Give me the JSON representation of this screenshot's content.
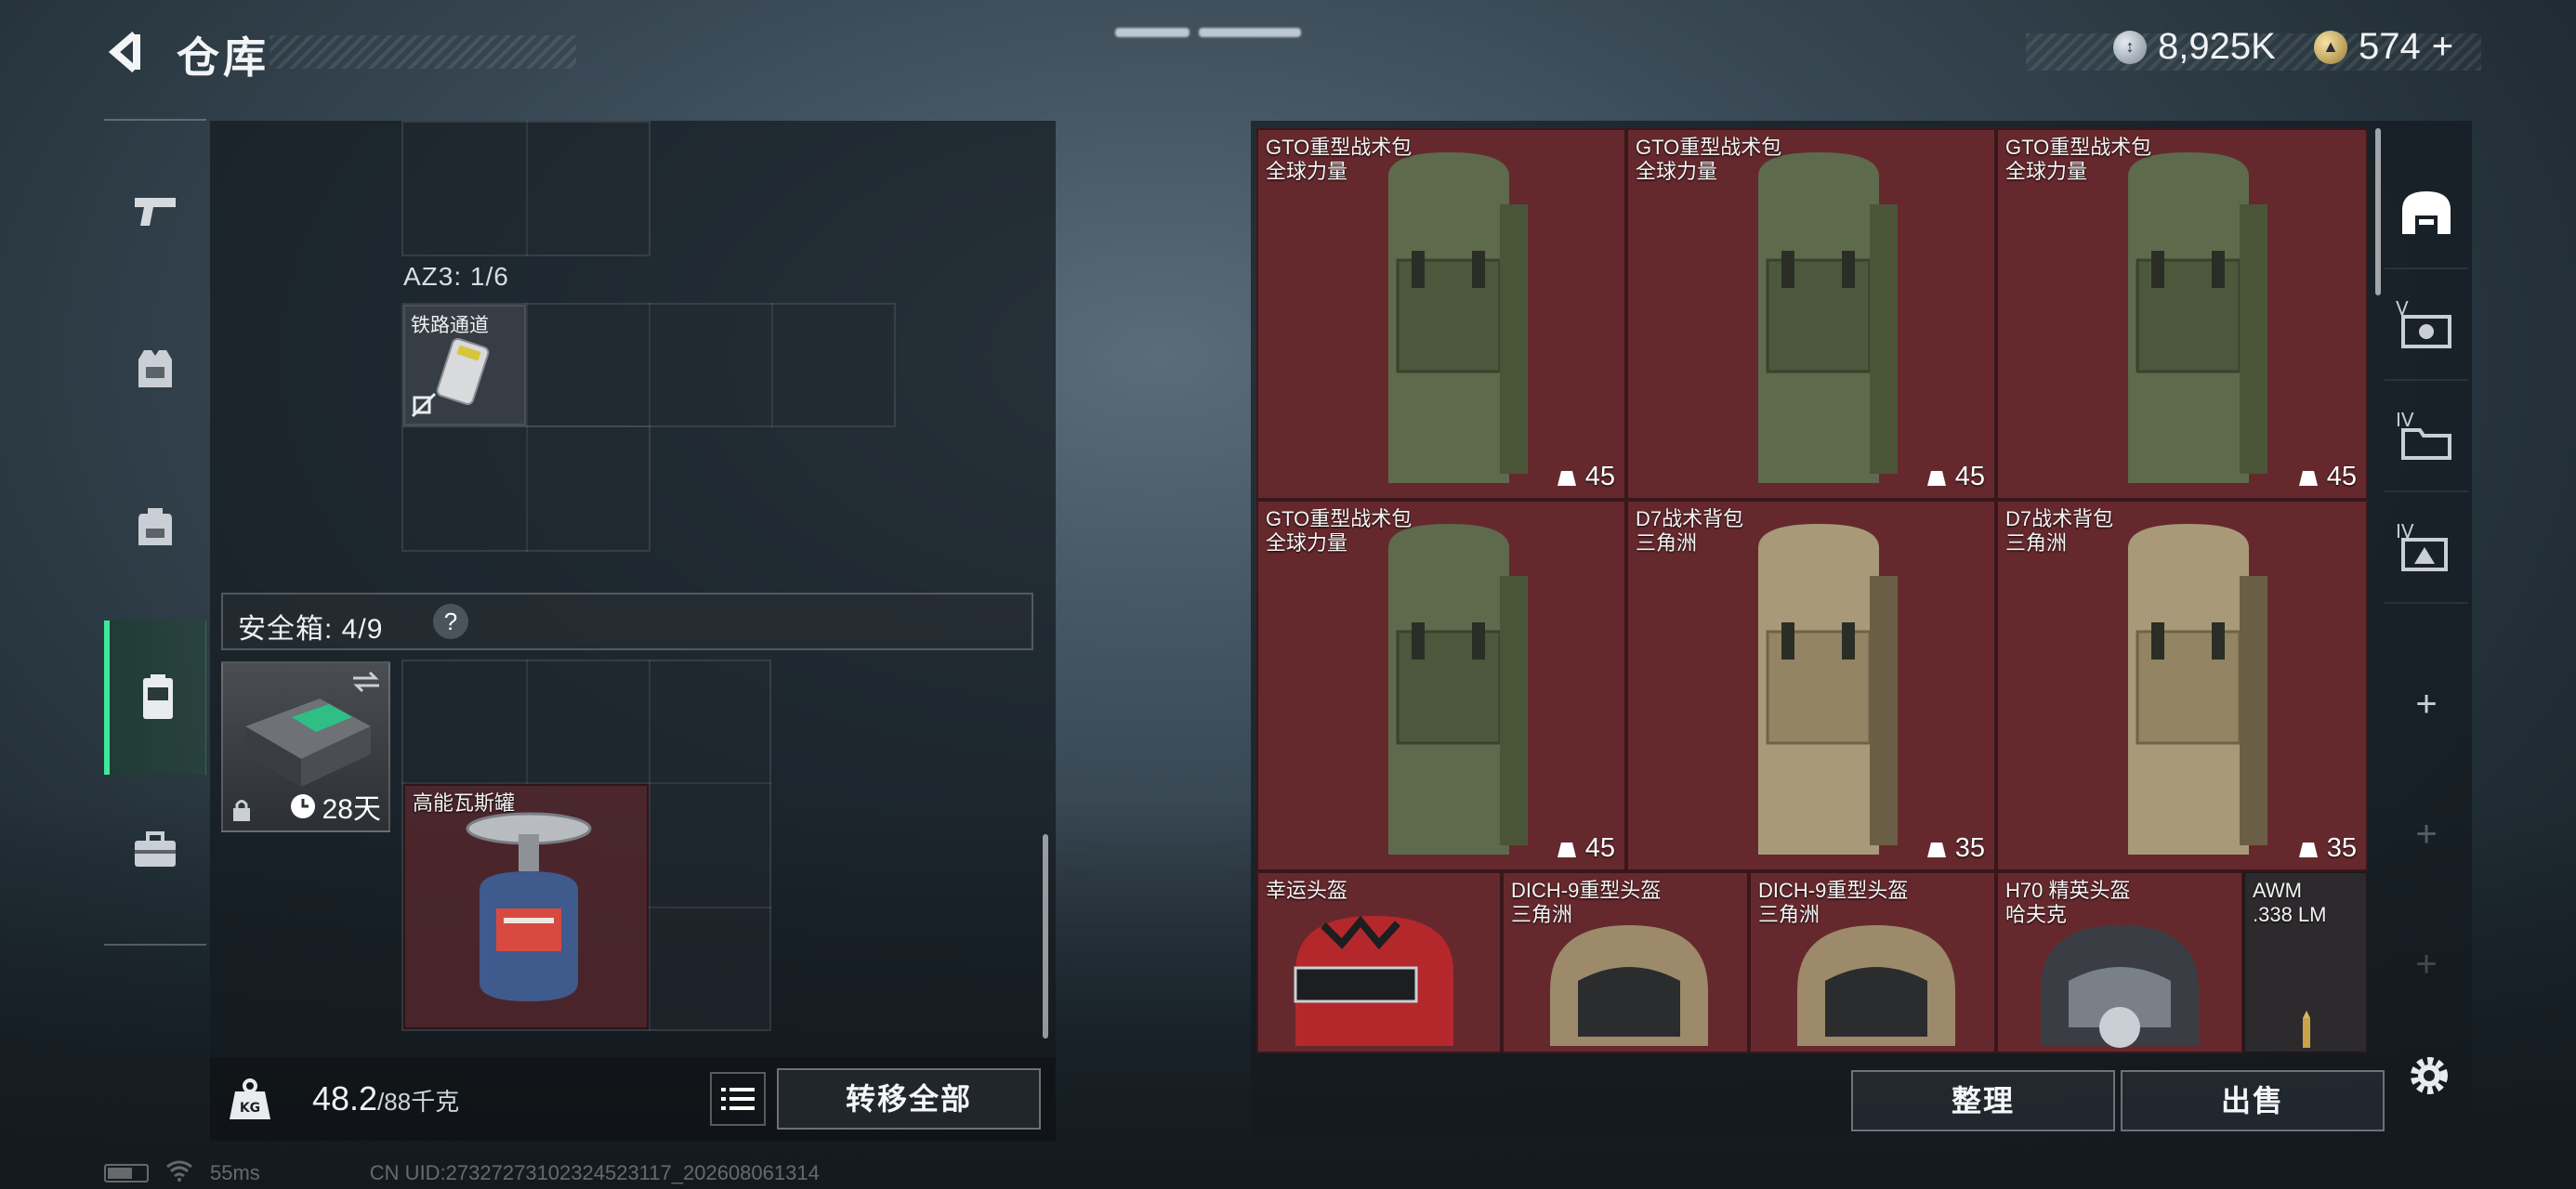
{
  "header": {
    "title": "仓库",
    "currency_silver": "8,925K",
    "currency_gold": "574",
    "currency_gold_plus": "+"
  },
  "left_panel": {
    "az3_label": "AZ3: 1/6",
    "railway_item": "铁路通道",
    "safebox_label": "安全箱: 4/9",
    "safebox_help": "?",
    "safebox_days": "28天",
    "gas_item": "高能瓦斯罐",
    "weight_current": "48.2",
    "weight_max": "/88千克",
    "transfer_all": "转移全部"
  },
  "inventory": {
    "items": [
      {
        "name": "GTO重型战术包",
        "sub": "全球力量",
        "durability": "45"
      },
      {
        "name": "GTO重型战术包",
        "sub": "全球力量",
        "durability": "45"
      },
      {
        "name": "GTO重型战术包",
        "sub": "全球力量",
        "durability": "45"
      },
      {
        "name": "GTO重型战术包",
        "sub": "全球力量",
        "durability": "45"
      },
      {
        "name": "D7战术背包",
        "sub": "三角洲",
        "durability": "35"
      },
      {
        "name": "D7战术背包",
        "sub": "三角洲",
        "durability": "35"
      }
    ],
    "helmets": [
      {
        "name": "幸运头盔",
        "sub": ""
      },
      {
        "name": "DICH-9重型头盔",
        "sub": "三角洲"
      },
      {
        "name": "DICH-9重型头盔",
        "sub": "三角洲"
      },
      {
        "name": "H70 精英头盔",
        "sub": "哈夫克"
      },
      {
        "name": "AWM",
        "sub": ".338 LM"
      }
    ],
    "sort_label": "整理",
    "sell_label": "出售"
  },
  "right_nav": {
    "tab2_label": "V",
    "tab3_label": "IV",
    "tab4_label": "IV",
    "add1": "+",
    "add2": "+",
    "add3": "+"
  },
  "status": {
    "ping": "55ms",
    "uid": "CN UID:27327273102324523117_202608061314"
  },
  "colors": {
    "accent_green": "#3ee79a",
    "tile_red": "#7a2c32",
    "panel_bg": "#1a2026"
  }
}
